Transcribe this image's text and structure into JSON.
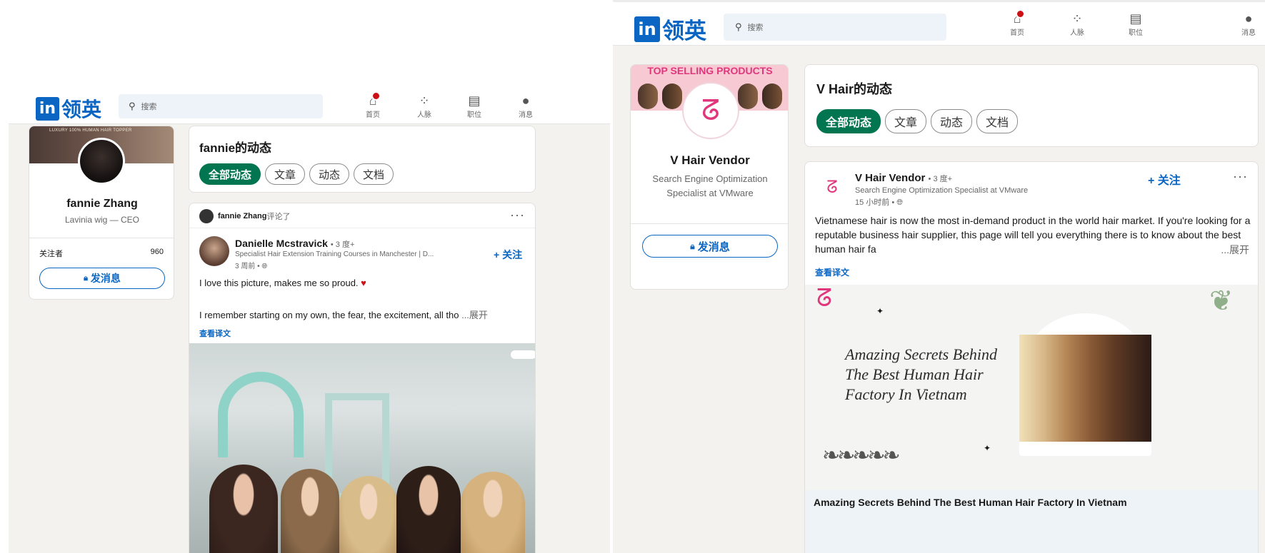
{
  "left": {
    "logo": {
      "in": "in",
      "cn": "领英"
    },
    "search": {
      "placeholder": "搜索"
    },
    "nav": [
      {
        "icon": "home-icon",
        "label": "首页"
      },
      {
        "icon": "people-icon",
        "label": "人脉"
      },
      {
        "icon": "briefcase-icon",
        "label": "职位"
      },
      {
        "icon": "message-icon",
        "label": "消息"
      }
    ],
    "profile": {
      "banner_text": "LUXURY 100% HUMAN HAIR TOPPER",
      "name": "fannie Zhang",
      "headline": "Lavinia wig — CEO",
      "followers_label": "关注者",
      "followers_count": "960",
      "message_button": "发消息"
    },
    "activity": {
      "title": "fannie的动态",
      "filters": [
        "全部动态",
        "文章",
        "动态",
        "文档"
      ]
    },
    "post": {
      "commenter": "fannie Zhang",
      "commented": "评论了",
      "author": "Danielle Mcstravick",
      "degree": "• 3 度+",
      "author_headline": "Specialist Hair Extension Training Courses in Manchester | D...",
      "time": "3 周前 •",
      "follow": "+ 关注",
      "text1": "I love this picture, makes me so proud.",
      "text2": "I remember starting on my own, the fear, the excitement, all tho",
      "expand": "...展开",
      "translate": "查看译文"
    }
  },
  "right": {
    "logo": {
      "in": "in",
      "cn": "领英"
    },
    "search": {
      "placeholder": "搜索"
    },
    "nav": [
      {
        "icon": "home-icon",
        "label": "首页"
      },
      {
        "icon": "people-icon",
        "label": "人脉"
      },
      {
        "icon": "briefcase-icon",
        "label": "职位"
      },
      {
        "icon": "message-icon",
        "label": "消息"
      }
    ],
    "profile": {
      "banner_text": "TOP SELLING PRODUCTS",
      "name": "V Hair Vendor",
      "headline": "Search Engine Optimization Specialist at VMware",
      "message_button": "发消息"
    },
    "activity": {
      "title": "V Hair的动态",
      "filters": [
        "全部动态",
        "文章",
        "动态",
        "文档"
      ]
    },
    "post": {
      "author": "V Hair Vendor",
      "degree": "• 3 度+",
      "author_headline": "Search Engine Optimization Specialist at VMware",
      "time": "15 小时前 •",
      "follow": "+ 关注",
      "text": "Vietnamese hair is now the most in-demand product in the world hair market. If you're looking for a reputable business hair supplier, this page will tell you everything there is to know about the best human hair fa",
      "expand": "...展开",
      "translate": "查看译文",
      "image_title": "Amazing Secrets Behind The Best Human Hair Factory In Vietnam",
      "link_title": "Amazing Secrets Behind The Best Human Hair Factory In Vietnam"
    }
  },
  "colors": {
    "brand": "#0a66c2",
    "active_filter": "#01754f",
    "notification": "#cc1016",
    "heart": "#cc1016"
  }
}
